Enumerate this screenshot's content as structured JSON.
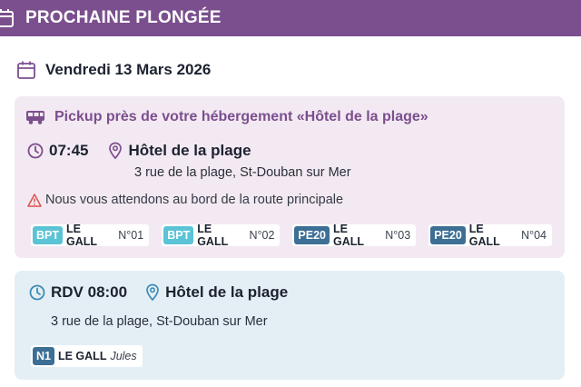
{
  "header": {
    "title": "PROCHAINE PLONGÉE",
    "icon": "calendar-icon",
    "color": "#7b4f8e"
  },
  "date": {
    "label": "Vendredi 13 Mars 2026",
    "icon": "calendar-icon"
  },
  "pickup": {
    "title": "Pickup près de votre hébergement «Hôtel de la plage»",
    "icon": "bus-icon",
    "time": "07:45",
    "place": "Hôtel de la plage",
    "address": "3 rue de la plage, St-Douban sur Mer",
    "notice": "Nous vous attendons au bord de la route principale",
    "divers": [
      {
        "level": "BPT",
        "name": "LE GALL",
        "number": "N°01"
      },
      {
        "level": "BPT",
        "name": "LE GALL",
        "number": "N°02"
      },
      {
        "level": "PE20",
        "name": "LE GALL",
        "number": "N°03"
      },
      {
        "level": "PE20",
        "name": "LE GALL",
        "number": "N°04"
      }
    ]
  },
  "rdv": {
    "time": "RDV 08:00",
    "place": "Hôtel de la plage",
    "address": "3 rue de la plage, St-Douban sur Mer",
    "diver": {
      "level": "N1",
      "name": "LE GALL",
      "first": "Jules"
    }
  }
}
